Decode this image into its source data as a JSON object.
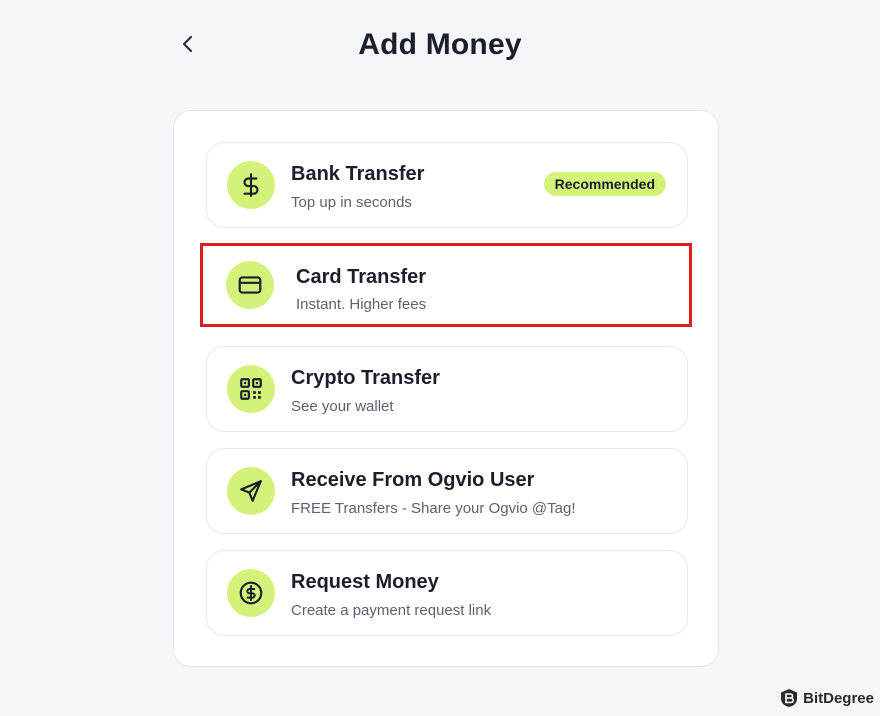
{
  "header": {
    "title": "Add Money",
    "back_icon": "chevron-left-icon"
  },
  "options": [
    {
      "icon": "dollar-icon",
      "title": "Bank Transfer",
      "subtitle": "Top up in seconds",
      "badge": "Recommended"
    },
    {
      "icon": "credit-card-icon",
      "title": "Card Transfer",
      "subtitle": "Instant. Higher fees",
      "highlighted": true
    },
    {
      "icon": "qr-code-icon",
      "title": "Crypto Transfer",
      "subtitle": "See your wallet"
    },
    {
      "icon": "send-icon",
      "title": "Receive From Ogvio User",
      "subtitle": "FREE Transfers - Share your Ogvio @Tag!"
    },
    {
      "icon": "dollar-circle-icon",
      "title": "Request Money",
      "subtitle": "Create a payment request link"
    }
  ],
  "watermark": {
    "text": "BitDegree",
    "icon": "bitdegree-logo-icon"
  },
  "colors": {
    "accent": "#d4f27a",
    "highlight_border": "#e21b1b",
    "background": "#f5f6f9",
    "text": "#1a1f2b"
  }
}
